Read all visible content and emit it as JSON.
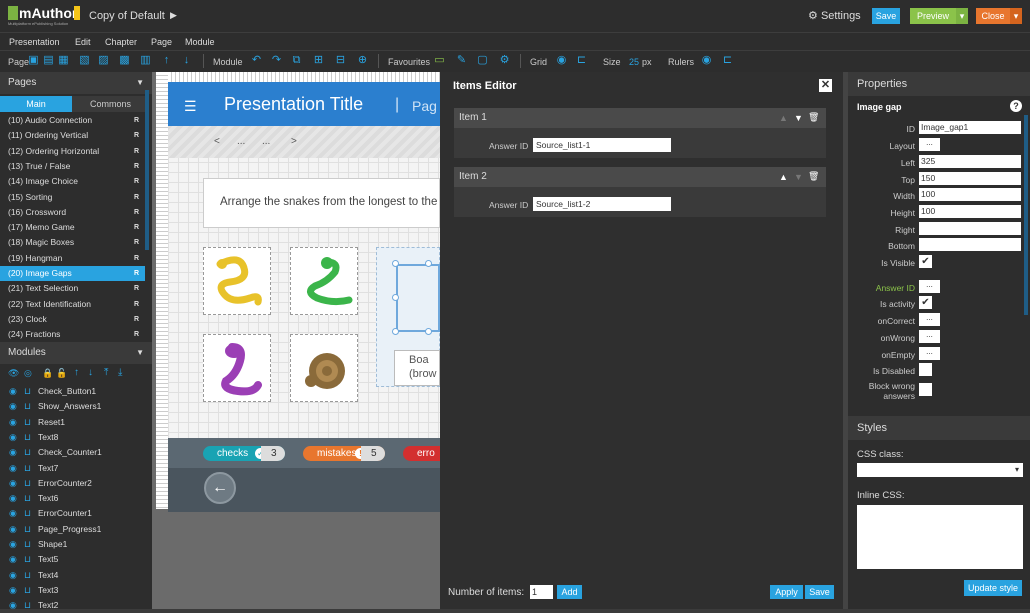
{
  "app": {
    "logo_text": "mAuthor",
    "logo_sub": "Multiplatform ePublishing Solution",
    "presentation_name": "Copy of Default",
    "settings_label": "Settings",
    "save_label": "Save",
    "preview_label": "Preview",
    "close_label": "Close",
    "colors": {
      "accent": "#29a3e0",
      "preview": "#8bc34a",
      "close": "#e8762e"
    }
  },
  "menu": [
    "Presentation",
    "Edit",
    "Chapter",
    "Page",
    "Module"
  ],
  "toolbar": {
    "page_label": "Page",
    "module_label": "Module",
    "favourites_label": "Favourites",
    "grid_label": "Grid",
    "size_label": "Size",
    "size_value": "25",
    "size_unit": "px",
    "rulers_label": "Rulers"
  },
  "pages_panel": {
    "title": "Pages",
    "tabs": [
      "Main",
      "Commons"
    ],
    "items": [
      {
        "label": "(10) Audio Connection",
        "flag": "R"
      },
      {
        "label": "(11) Ordering Vertical",
        "flag": "R"
      },
      {
        "label": "(12) Ordering Horizontal",
        "flag": "R"
      },
      {
        "label": "(13) True / False",
        "flag": "R"
      },
      {
        "label": "(14) Image Choice",
        "flag": "R"
      },
      {
        "label": "(15) Sorting",
        "flag": "R"
      },
      {
        "label": "(16) Crossword",
        "flag": "R"
      },
      {
        "label": "(17) Memo Game",
        "flag": "R"
      },
      {
        "label": "(18) Magic Boxes",
        "flag": "R"
      },
      {
        "label": "(19) Hangman",
        "flag": "R"
      },
      {
        "label": "(20) Image Gaps",
        "flag": "R"
      },
      {
        "label": "(21) Text Selection",
        "flag": "R"
      },
      {
        "label": "(22) Text Identification",
        "flag": "R"
      },
      {
        "label": "(23) Clock",
        "flag": "R"
      },
      {
        "label": "(24) Fractions",
        "flag": "R"
      }
    ],
    "selected": "(20) Image Gaps"
  },
  "modules_panel": {
    "title": "Modules",
    "items": [
      "Check_Button1",
      "Show_Answers1",
      "Reset1",
      "Text8",
      "Check_Counter1",
      "Text7",
      "ErrorCounter2",
      "Text6",
      "ErrorCounter1",
      "Page_Progress1",
      "Shape1",
      "Text5",
      "Text4",
      "Text3",
      "Text2"
    ]
  },
  "stage": {
    "title": "Presentation Title",
    "separator": "|",
    "page_partial": "Pag",
    "nav_prev": "<",
    "nav_dots1": "...",
    "nav_dots2": "...",
    "nav_next": ">",
    "instruction": "Arrange the snakes from the longest to the shortest",
    "board_label": "Boa\n(brow",
    "counters": [
      {
        "label": "checks",
        "value": "3",
        "color": "#19a3b3",
        "icon": "check-icon"
      },
      {
        "label": "mistakes",
        "value": "5",
        "color": "#e8762e",
        "icon": "exclamation-icon"
      },
      {
        "label": "erro",
        "value": "",
        "color": "#d32f2f",
        "icon": ""
      }
    ],
    "back_arrow": "←"
  },
  "items_editor": {
    "title": "Items Editor",
    "items": [
      {
        "title": "Item 1",
        "answer_label": "Answer ID",
        "answer_value": "Source_list1-1"
      },
      {
        "title": "Item 2",
        "answer_label": "Answer ID",
        "answer_value": "Source_list1-2"
      }
    ],
    "num_items_label": "Number of items:",
    "num_items_value": "1",
    "add_label": "Add",
    "apply_label": "Apply",
    "save_label": "Save"
  },
  "properties": {
    "title": "Properties",
    "module_type": "Image gap",
    "fields": {
      "id": {
        "label": "ID",
        "value": "Image_gap1"
      },
      "layout": {
        "label": "Layout",
        "value": "..."
      },
      "left": {
        "label": "Left",
        "value": "325"
      },
      "top": {
        "label": "Top",
        "value": "150"
      },
      "width": {
        "label": "Width",
        "value": "100"
      },
      "height": {
        "label": "Height",
        "value": "100"
      },
      "right": {
        "label": "Right",
        "value": ""
      },
      "bottom": {
        "label": "Bottom",
        "value": ""
      },
      "is_visible": {
        "label": "Is Visible",
        "checked": true
      },
      "answer_id": {
        "label": "Answer ID",
        "value": "..."
      },
      "is_activity": {
        "label": "Is activity",
        "checked": true
      },
      "on_correct": {
        "label": "onCorrect",
        "value": "..."
      },
      "on_wrong": {
        "label": "onWrong",
        "value": "..."
      },
      "on_empty": {
        "label": "onEmpty",
        "value": "..."
      },
      "is_disabled": {
        "label": "Is Disabled",
        "checked": false
      },
      "block_wrong": {
        "label": "Block wrong answers",
        "checked": false
      }
    },
    "styles_title": "Styles",
    "css_class_label": "CSS class:",
    "inline_css_label": "Inline CSS:",
    "update_style_label": "Update style"
  }
}
